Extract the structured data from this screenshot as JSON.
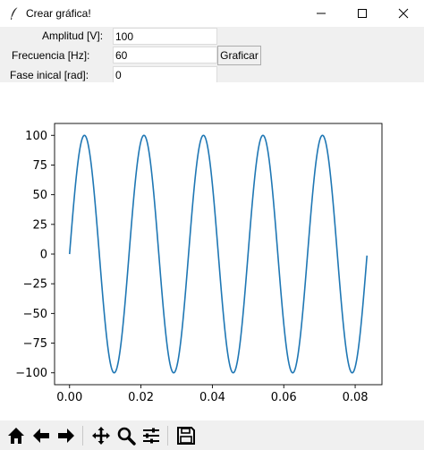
{
  "window": {
    "title": "Crear gráfica!",
    "icon": "feather-icon"
  },
  "form": {
    "amplitude_label": "Amplitud [V]:",
    "amplitude_value": "100",
    "frequency_label": "Frecuencia [Hz]:",
    "frequency_value": "60",
    "phase_label": "Fase inical [rad]:",
    "phase_value": "0",
    "plot_button": "Graficar"
  },
  "toolbar": {
    "buttons": [
      "home-icon",
      "back-arrow-icon",
      "forward-arrow-icon",
      "pan-icon",
      "zoom-icon",
      "configure-subplots-icon",
      "save-icon"
    ]
  },
  "chart_data": {
    "type": "line",
    "title": "",
    "xlabel": "",
    "ylabel": "",
    "xlim": [
      -0.0042,
      0.0875
    ],
    "ylim": [
      -110,
      110
    ],
    "xticks": [
      0.0,
      0.02,
      0.04,
      0.06,
      0.08
    ],
    "xtick_labels": [
      "0.00",
      "0.02",
      "0.04",
      "0.06",
      "0.08"
    ],
    "yticks": [
      100,
      75,
      50,
      25,
      0,
      -25,
      -50,
      -75,
      -100
    ],
    "ytick_labels": [
      "100",
      "75",
      "50",
      "25",
      "0",
      "−25",
      "−50",
      "−75",
      "−100"
    ],
    "grid": false,
    "series": [
      {
        "color": "#1f77b4",
        "function": "100*sin(2*pi*60*x + 0)",
        "x_range": [
          0,
          0.0833
        ]
      }
    ]
  }
}
